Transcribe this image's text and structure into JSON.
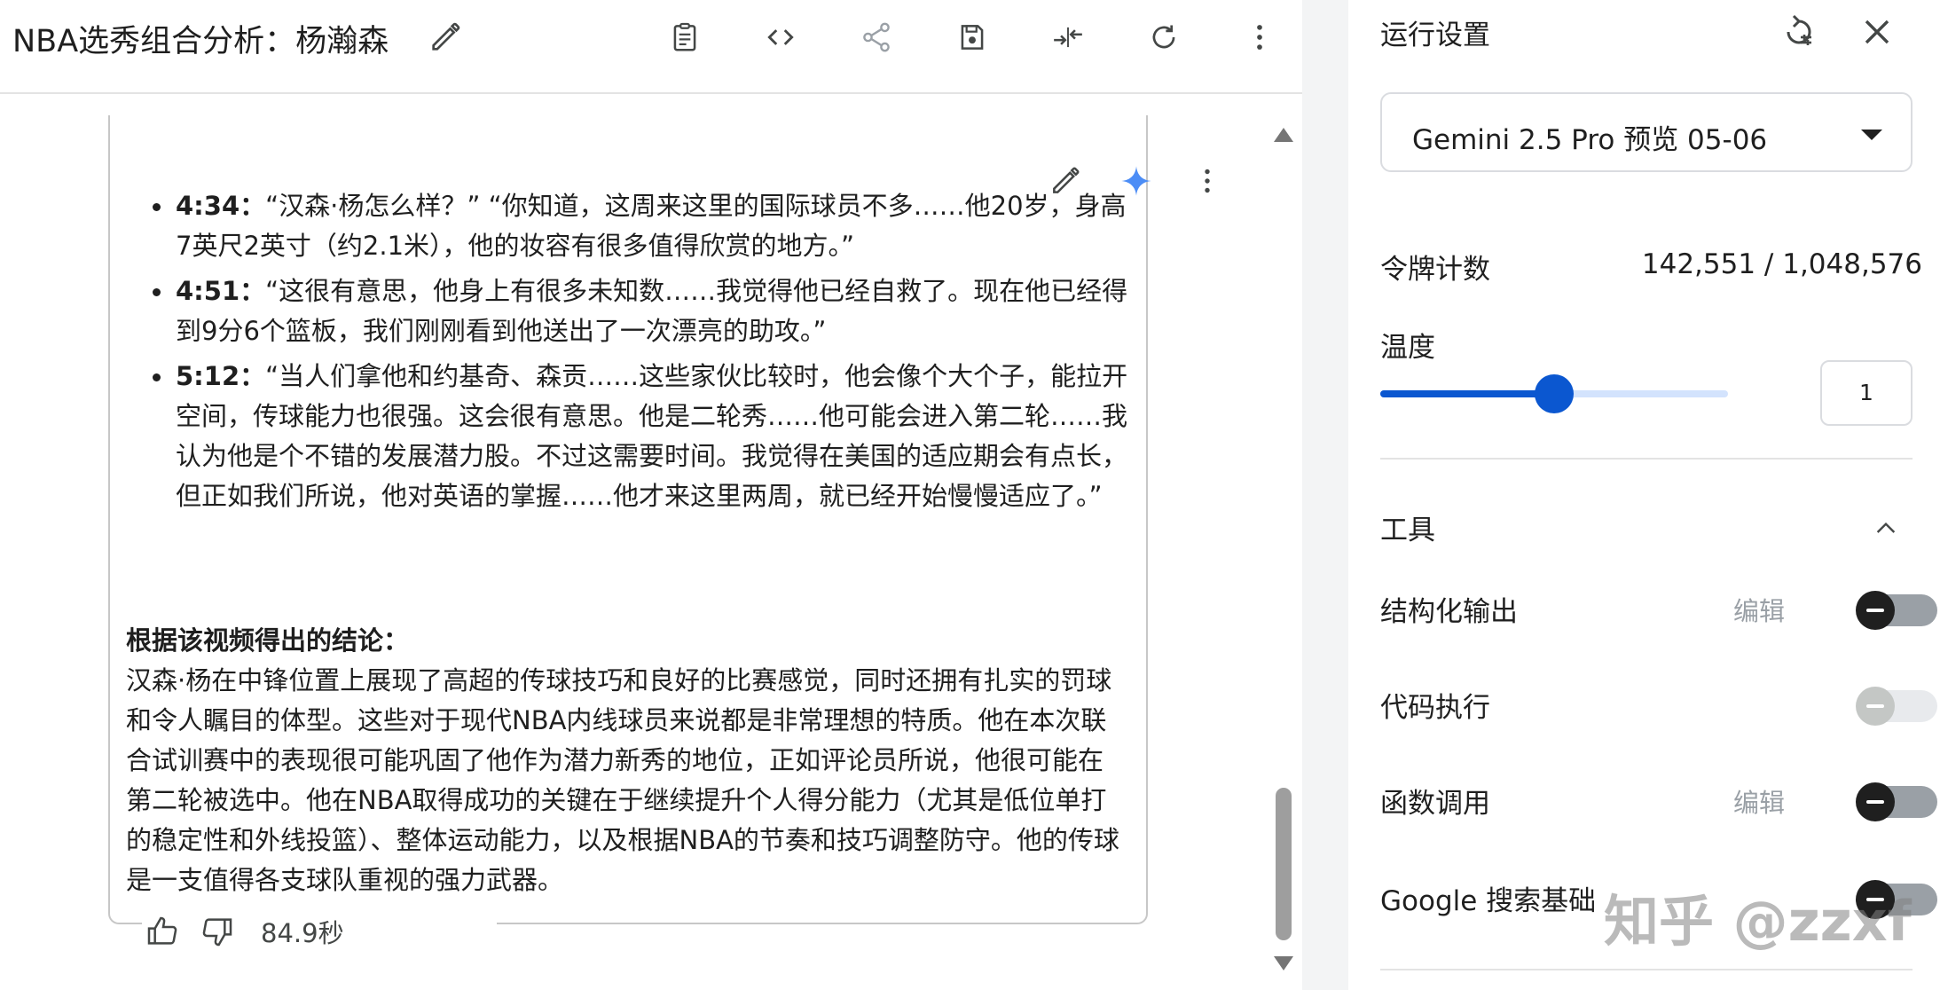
{
  "header": {
    "title": "NBA选秀组合分析：杨瀚森"
  },
  "response": {
    "bullets": [
      {
        "time": "4:34：",
        "text": "“汉森·杨怎么样？” “你知道，这周来这里的国际球员不多……他20岁，身高7英尺2英寸（约2.1米），他的妆容有很多值得欣赏的地方。”"
      },
      {
        "time": "4:51：",
        "text": "“这很有意思，他身上有很多未知数……我觉得他已经自救了。现在他已经得到9分6个篮板，我们刚刚看到他送出了一次漂亮的助攻。”"
      },
      {
        "time": "5:12：",
        "text": "“当人们拿他和约基奇、森贡……这些家伙比较时，他会像个大个子，能拉开空间，传球能力也很强。这会很有意思。他是二轮秀……他可能会进入第二轮……我认为他是个不错的发展潜力股。不过这需要时间。我觉得在美国的适应期会有点长，但正如我们所说，他对英语的掌握……他才来这里两周，就已经开始慢慢适应了。”"
      }
    ],
    "conclusion_title": "根据该视频得出的结论：",
    "conclusion_body": "汉森·杨在中锋位置上展现了高超的传球技巧和良好的比赛感觉，同时还拥有扎实的罚球和令人瞩目的体型。这些对于现代NBA内线球员来说都是非常理想的特质。他在本次联合试训赛中的表现很可能巩固了他作为潜力新秀的地位，正如评论员所说，他很可能在第二轮被选中。他在NBA取得成功的关键在于继续提升个人得分能力（尤其是低位单打的稳定性和外线投篮）、整体运动能力，以及根据NBA的节奏和技巧调整防守。他的传球是一支值得各支球队重视的强力武器。",
    "elapsed": "84.9秒"
  },
  "settings": {
    "title": "运行设置",
    "model": "Gemini 2.5 Pro 预览 05-06",
    "token_label": "令牌计数",
    "token_value": "142,551 / 1,048,576",
    "temperature_label": "温度",
    "temperature_value": "1",
    "temperature_fraction": 0.5,
    "tools_label": "工具",
    "tools": [
      {
        "name": "结构化输出",
        "edit": "编辑",
        "enabled": false,
        "disabled": false
      },
      {
        "name": "代码执行",
        "edit": "",
        "enabled": false,
        "disabled": true
      },
      {
        "name": "函数调用",
        "edit": "编辑",
        "enabled": false,
        "disabled": false
      },
      {
        "name": "Google 搜索基础",
        "edit": "",
        "enabled": false,
        "disabled": false
      }
    ]
  },
  "watermark": "知乎 @zzxf",
  "colors": {
    "accent": "#0b57d0",
    "accent_light": "#d3e3fd",
    "gemini_spark": "#4c8df6"
  },
  "icons": [
    "edit-icon",
    "notes-icon",
    "code-icon",
    "share-icon",
    "save-icon",
    "compare-icon",
    "refresh-icon",
    "more-vert-icon",
    "sparkle-icon",
    "thumb-up-icon",
    "thumb-down-icon",
    "reset-settings-icon",
    "close-icon",
    "chevron-up-icon"
  ]
}
